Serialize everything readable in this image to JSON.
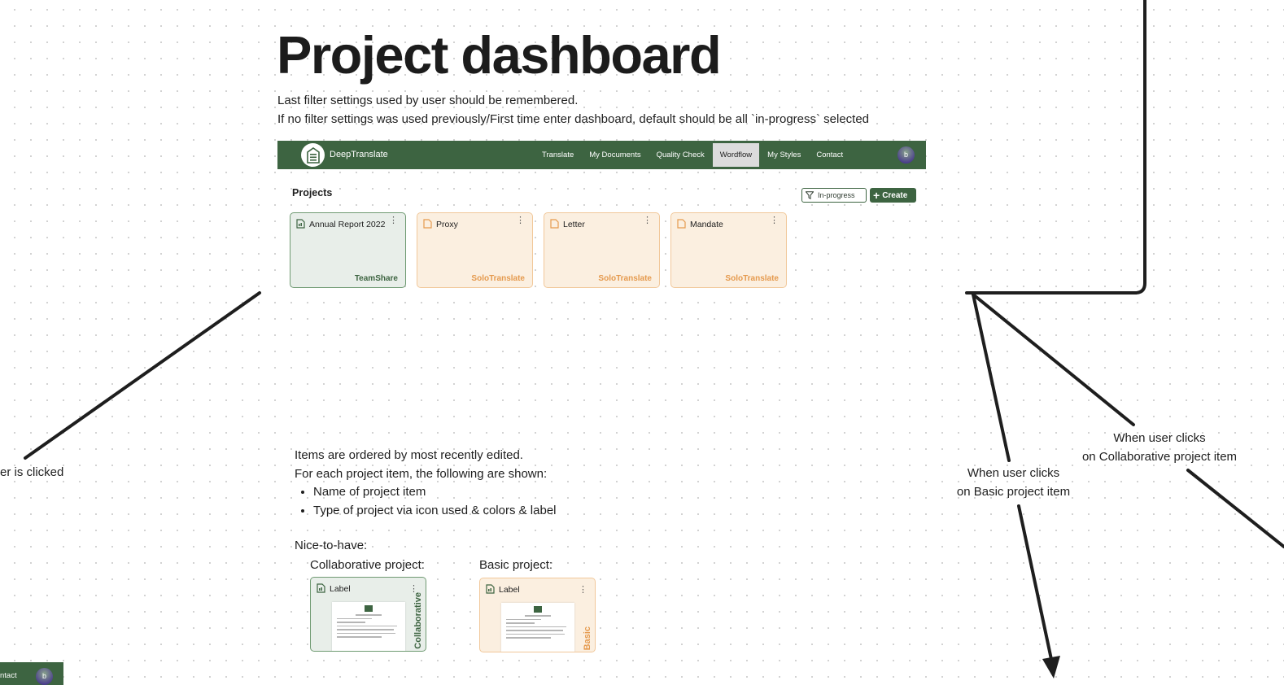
{
  "page": {
    "title": "Project dashboard",
    "description_lines": [
      "Last filter settings used by user should be remembered.",
      "If no filter settings was used previously/First time enter dashboard, default should be all `in-progress` selected"
    ]
  },
  "app": {
    "brand": "DeepTranslate",
    "nav": [
      "Translate",
      "My Documents",
      "Quality Check",
      "Wordflow",
      "My Styles",
      "Contact"
    ],
    "active_nav": "Wordflow",
    "avatar_initial": "b",
    "colors": {
      "primary": "#3d6441",
      "team_bg": "#e8eee9",
      "solo_bg": "#fbefe0",
      "solo_accent": "#e59a4e"
    }
  },
  "projects": {
    "title": "Projects",
    "filter_label": "In-progress",
    "create_label": "Create",
    "items": [
      {
        "name": "Annual Report 2022",
        "type": "TeamShare",
        "icon": "spreadsheet-doc-icon"
      },
      {
        "name": "Proxy",
        "type": "SoloTranslate",
        "icon": "document-icon"
      },
      {
        "name": "Letter",
        "type": "SoloTranslate",
        "icon": "document-icon"
      },
      {
        "name": "Mandate",
        "type": "SoloTranslate",
        "icon": "document-icon"
      }
    ]
  },
  "notes": {
    "line1": "Items are ordered by most recently edited.",
    "line2": "For each project item, the following are shown:",
    "bullets": [
      "Name of project item",
      "Type of project via icon used & colors & label"
    ]
  },
  "nice_to_have": {
    "heading": "Nice-to-have:",
    "collab_heading": "Collaborative project:",
    "basic_heading": "Basic project:",
    "collab_card": {
      "label": "Label",
      "vertical": "Collaborative"
    },
    "basic_card": {
      "label": "Label",
      "vertical": "Basic"
    }
  },
  "annotations": {
    "left_cut": "er is clicked",
    "basic_click": [
      "When user clicks",
      "on Basic project item"
    ],
    "collab_click": [
      "When user clicks",
      "on Collaborative project item"
    ]
  },
  "mini_nav": {
    "text": "ntact",
    "avatar_initial": "b"
  }
}
